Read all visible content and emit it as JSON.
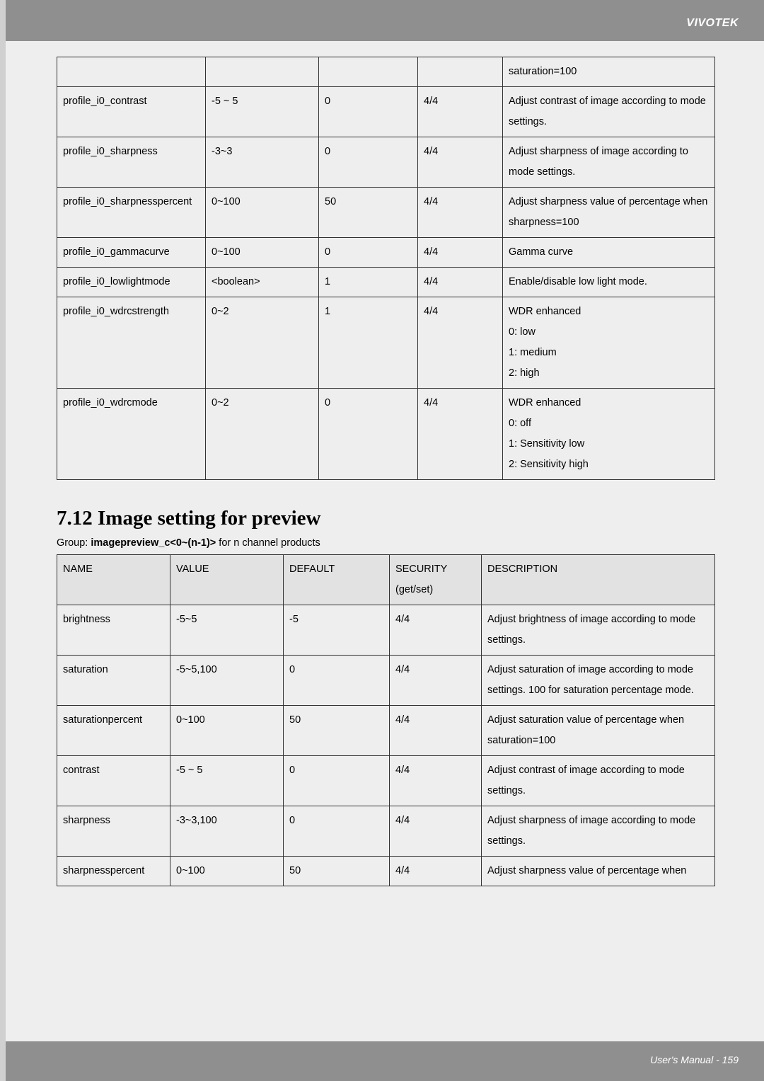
{
  "brand": "VIVOTEK",
  "footer": "User's Manual - 159",
  "table1": {
    "rows": [
      {
        "name": "",
        "value": "",
        "default": "",
        "security": "",
        "description": "saturation=100"
      },
      {
        "name": "profile_i0_contrast",
        "value": "-5 ~ 5",
        "default": "0",
        "security": "4/4",
        "description": "Adjust contrast of image according to mode settings."
      },
      {
        "name": "profile_i0_sharpness",
        "value": "-3~3",
        "default": "0",
        "security": "4/4",
        "description": "Adjust sharpness of image according to mode settings."
      },
      {
        "name": "profile_i0_sharpnesspercent",
        "value": "0~100",
        "default": "50",
        "security": "4/4",
        "description": "Adjust sharpness value of percentage when sharpness=100"
      },
      {
        "name": "profile_i0_gammacurve",
        "value": "0~100",
        "default": "0",
        "security": "4/4",
        "description": "Gamma curve"
      },
      {
        "name": "profile_i0_lowlightmode",
        "value": "<boolean>",
        "default": "1",
        "security": "4/4",
        "description": "Enable/disable low light mode."
      },
      {
        "name": "profile_i0_wdrcstrength",
        "value": "0~2",
        "default": "1",
        "security": "4/4",
        "description": "WDR enhanced\n0: low\n1: medium\n2: high"
      },
      {
        "name": "profile_i0_wdrcmode",
        "value": "0~2",
        "default": "0",
        "security": "4/4",
        "description": "WDR enhanced\n0: off\n1: Sensitivity low\n2: Sensitivity high"
      }
    ]
  },
  "section": {
    "heading": "7.12 Image setting for preview",
    "group_prefix": "Group: ",
    "group_name": "imagepreview_c<0~(n-1)>",
    "group_suffix": " for n channel products"
  },
  "table2": {
    "headers": {
      "name": "NAME",
      "value": "VALUE",
      "default": "DEFAULT",
      "security": "SECURITY (get/set)",
      "description": "DESCRIPTION"
    },
    "rows": [
      {
        "name": "brightness",
        "value": "-5~5",
        "default": "-5",
        "security": "4/4",
        "description": "Adjust brightness of image according to mode settings."
      },
      {
        "name": "saturation",
        "value": "-5~5,100",
        "default": "0",
        "security": "4/4",
        "description": "Adjust saturation of image according to mode settings. 100 for saturation percentage mode."
      },
      {
        "name": "saturationpercent",
        "value": "0~100",
        "default": "50",
        "security": "4/4",
        "description": "Adjust saturation value of percentage when saturation=100"
      },
      {
        "name": "contrast",
        "value": "-5 ~ 5",
        "default": "0",
        "security": "4/4",
        "description": "Adjust contrast of image according to mode settings."
      },
      {
        "name": "sharpness",
        "value": "-3~3,100",
        "default": "0",
        "security": "4/4",
        "description": "Adjust sharpness of image according to mode settings."
      },
      {
        "name": "sharpnesspercent",
        "value": "0~100",
        "default": "50",
        "security": "4/4",
        "description": "Adjust sharpness value of percentage when"
      }
    ]
  }
}
